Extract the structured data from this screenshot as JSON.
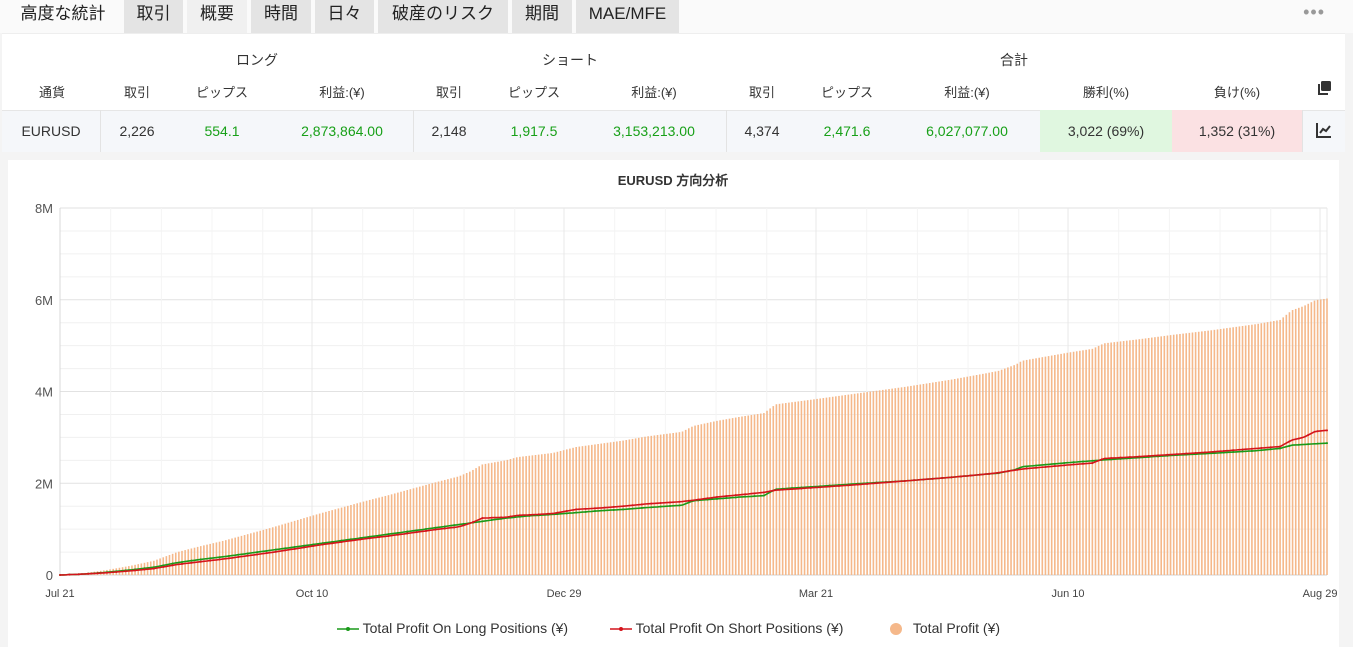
{
  "tabs": [
    {
      "label": "高度な統計",
      "state": "plain"
    },
    {
      "label": "取引",
      "state": "normal"
    },
    {
      "label": "概要",
      "state": "active"
    },
    {
      "label": "時間",
      "state": "normal"
    },
    {
      "label": "日々",
      "state": "normal"
    },
    {
      "label": "破産のリスク",
      "state": "normal"
    },
    {
      "label": "期間",
      "state": "normal"
    },
    {
      "label": "MAE/MFE",
      "state": "normal"
    }
  ],
  "more_icon": "ellipsis-icon",
  "table": {
    "group_long": "ロング",
    "group_short": "ショート",
    "group_total": "合計",
    "headers": {
      "currency": "通貨",
      "long_trades": "取引",
      "long_pips": "ピップス",
      "long_profit": "利益:(¥)",
      "short_trades": "取引",
      "short_pips": "ピップス",
      "short_profit": "利益:(¥)",
      "total_trades": "取引",
      "total_pips": "ピップス",
      "total_profit": "利益:(¥)",
      "win": "勝利(%)",
      "loss": "負け(%)"
    },
    "row": {
      "currency": "EURUSD",
      "long_trades": "2,226",
      "long_pips": "554.1",
      "long_profit": "2,873,864.00",
      "short_trades": "2,148",
      "short_pips": "1,917.5",
      "short_profit": "3,153,213.00",
      "total_trades": "4,374",
      "total_pips": "2,471.6",
      "total_profit": "6,027,077.00",
      "win": "3,022 (69%)",
      "loss": "1,352 (31%)"
    },
    "icons": {
      "copy": "copy-icon",
      "chart": "chart-line-icon"
    },
    "colors": {
      "positive": "#18a018",
      "win_bg": "#e0f7e0",
      "loss_bg": "#fbe1e3"
    }
  },
  "chart_data": {
    "type": "bar",
    "title": "EURUSD 方向分析",
    "x_tick_labels": [
      "Jul 21",
      "Oct 10",
      "Dec 29",
      "Mar 21",
      "Jun 10",
      "Aug 29"
    ],
    "y_tick_labels": [
      "0",
      "2M",
      "4M",
      "6M",
      "8M"
    ],
    "ylim": [
      0,
      8000000
    ],
    "grid": true,
    "legend_position": "bottom-center",
    "x_index_range": [
      0,
      405
    ],
    "series": [
      {
        "name": "Total Profit On Long Positions (¥)",
        "type": "line",
        "color": "#1a9a1a",
        "points": [
          [
            0,
            0
          ],
          [
            20,
            20000
          ],
          [
            40,
            60000
          ],
          [
            60,
            110000
          ],
          [
            80,
            170000
          ],
          [
            100,
            270000
          ],
          [
            120,
            340000
          ],
          [
            140,
            400000
          ],
          [
            160,
            470000
          ],
          [
            180,
            540000
          ],
          [
            200,
            610000
          ],
          [
            220,
            680000
          ],
          [
            240,
            750000
          ],
          [
            260,
            820000
          ],
          [
            280,
            890000
          ],
          [
            300,
            960000
          ],
          [
            320,
            1030000
          ],
          [
            340,
            1100000
          ],
          [
            360,
            1170000
          ],
          [
            380,
            1240000
          ],
          [
            400,
            1290000
          ],
          [
            420,
            1320000
          ],
          [
            440,
            1360000
          ],
          [
            460,
            1400000
          ],
          [
            480,
            1430000
          ],
          [
            500,
            1470000
          ],
          [
            530,
            1520000
          ],
          [
            540,
            1620000
          ],
          [
            560,
            1660000
          ],
          [
            580,
            1700000
          ],
          [
            600,
            1730000
          ],
          [
            610,
            1870000
          ],
          [
            640,
            1920000
          ],
          [
            680,
            1990000
          ],
          [
            720,
            2050000
          ],
          [
            760,
            2130000
          ],
          [
            790,
            2200000
          ],
          [
            800,
            2220000
          ],
          [
            815,
            2300000
          ],
          [
            820,
            2360000
          ],
          [
            860,
            2450000
          ],
          [
            880,
            2490000
          ],
          [
            890,
            2510000
          ],
          [
            920,
            2560000
          ],
          [
            950,
            2610000
          ],
          [
            980,
            2650000
          ],
          [
            1000,
            2680000
          ],
          [
            1020,
            2710000
          ],
          [
            1040,
            2760000
          ],
          [
            1050,
            2830000
          ],
          [
            1070,
            2860000
          ],
          [
            1080,
            2873864
          ]
        ]
      },
      {
        "name": "Total Profit On Short Positions (¥)",
        "type": "line",
        "color": "#d4141c",
        "points": [
          [
            0,
            0
          ],
          [
            20,
            20000
          ],
          [
            40,
            50000
          ],
          [
            60,
            90000
          ],
          [
            80,
            140000
          ],
          [
            100,
            230000
          ],
          [
            120,
            290000
          ],
          [
            140,
            350000
          ],
          [
            160,
            420000
          ],
          [
            180,
            490000
          ],
          [
            200,
            570000
          ],
          [
            220,
            650000
          ],
          [
            240,
            720000
          ],
          [
            260,
            790000
          ],
          [
            280,
            850000
          ],
          [
            300,
            920000
          ],
          [
            320,
            990000
          ],
          [
            340,
            1050000
          ],
          [
            350,
            1130000
          ],
          [
            360,
            1240000
          ],
          [
            380,
            1260000
          ],
          [
            390,
            1300000
          ],
          [
            400,
            1310000
          ],
          [
            420,
            1340000
          ],
          [
            440,
            1430000
          ],
          [
            460,
            1460000
          ],
          [
            480,
            1500000
          ],
          [
            500,
            1550000
          ],
          [
            530,
            1600000
          ],
          [
            540,
            1630000
          ],
          [
            560,
            1700000
          ],
          [
            580,
            1750000
          ],
          [
            600,
            1800000
          ],
          [
            610,
            1850000
          ],
          [
            640,
            1900000
          ],
          [
            680,
            1970000
          ],
          [
            720,
            2050000
          ],
          [
            760,
            2130000
          ],
          [
            790,
            2200000
          ],
          [
            800,
            2230000
          ],
          [
            815,
            2290000
          ],
          [
            820,
            2310000
          ],
          [
            860,
            2400000
          ],
          [
            880,
            2440000
          ],
          [
            890,
            2540000
          ],
          [
            920,
            2580000
          ],
          [
            950,
            2630000
          ],
          [
            980,
            2680000
          ],
          [
            1000,
            2720000
          ],
          [
            1020,
            2760000
          ],
          [
            1040,
            2800000
          ],
          [
            1050,
            2940000
          ],
          [
            1060,
            3000000
          ],
          [
            1070,
            3130000
          ],
          [
            1080,
            3153213
          ]
        ]
      },
      {
        "name": "Total Profit (¥)",
        "type": "bar",
        "color": "#f5b88a",
        "points": [
          [
            0,
            0
          ],
          [
            20,
            40000
          ],
          [
            40,
            110000
          ],
          [
            60,
            200000
          ],
          [
            80,
            310000
          ],
          [
            100,
            500000
          ],
          [
            120,
            630000
          ],
          [
            140,
            750000
          ],
          [
            160,
            890000
          ],
          [
            180,
            1030000
          ],
          [
            200,
            1180000
          ],
          [
            220,
            1330000
          ],
          [
            240,
            1470000
          ],
          [
            260,
            1610000
          ],
          [
            280,
            1740000
          ],
          [
            300,
            1880000
          ],
          [
            320,
            2020000
          ],
          [
            340,
            2150000
          ],
          [
            350,
            2260000
          ],
          [
            360,
            2410000
          ],
          [
            380,
            2500000
          ],
          [
            390,
            2570000
          ],
          [
            400,
            2600000
          ],
          [
            420,
            2660000
          ],
          [
            440,
            2790000
          ],
          [
            460,
            2860000
          ],
          [
            480,
            2930000
          ],
          [
            500,
            3020000
          ],
          [
            530,
            3120000
          ],
          [
            540,
            3250000
          ],
          [
            560,
            3360000
          ],
          [
            580,
            3450000
          ],
          [
            600,
            3530000
          ],
          [
            610,
            3720000
          ],
          [
            640,
            3820000
          ],
          [
            680,
            3960000
          ],
          [
            720,
            4100000
          ],
          [
            760,
            4260000
          ],
          [
            790,
            4400000
          ],
          [
            800,
            4450000
          ],
          [
            815,
            4590000
          ],
          [
            820,
            4670000
          ],
          [
            860,
            4850000
          ],
          [
            880,
            4930000
          ],
          [
            890,
            5050000
          ],
          [
            920,
            5140000
          ],
          [
            950,
            5240000
          ],
          [
            980,
            5330000
          ],
          [
            1000,
            5400000
          ],
          [
            1020,
            5470000
          ],
          [
            1040,
            5560000
          ],
          [
            1050,
            5770000
          ],
          [
            1060,
            5860000
          ],
          [
            1070,
            5990000
          ],
          [
            1080,
            6027077
          ]
        ]
      }
    ]
  }
}
